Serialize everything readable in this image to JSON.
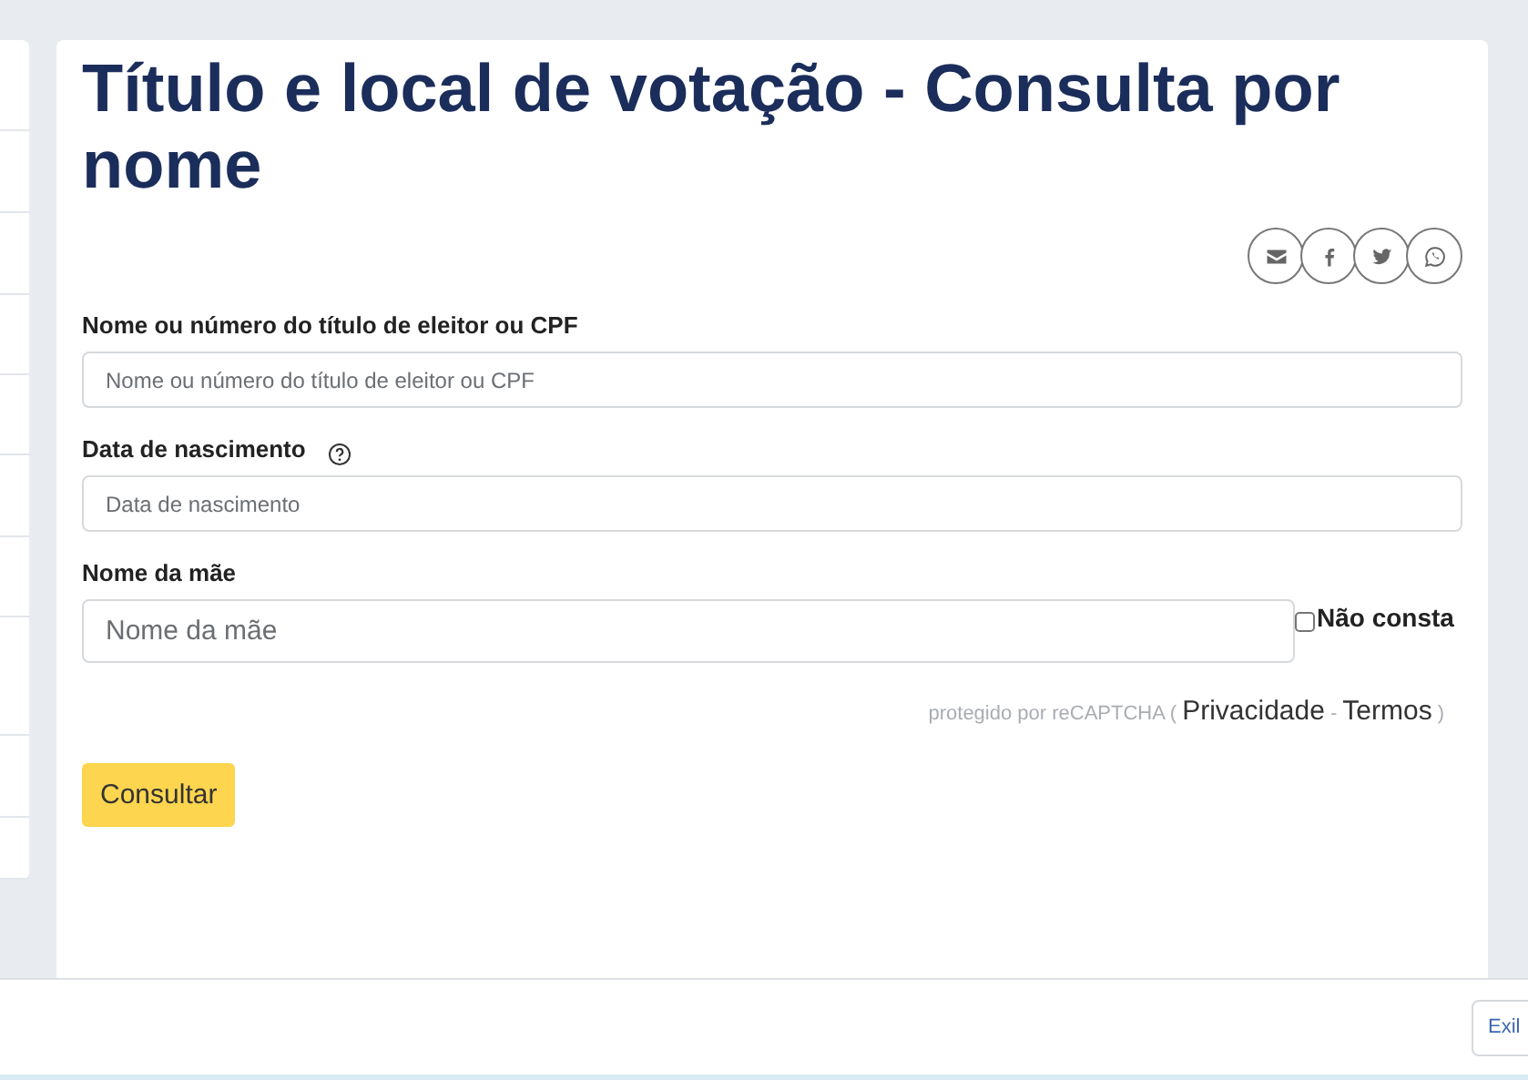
{
  "title": "Título e local de votação - Consulta por nome",
  "share_buttons": [
    {
      "kind": "email"
    },
    {
      "kind": "facebook"
    },
    {
      "kind": "twitter"
    },
    {
      "kind": "whatsapp"
    }
  ],
  "fields": [
    {
      "kind": "plain",
      "label": "Nome ou número do título de eleitor ou CPF",
      "placeholder": "Nome ou número do título de eleitor ou CPF"
    },
    {
      "kind": "help",
      "label": "Data de nascimento",
      "placeholder": "Data de nascimento"
    },
    {
      "kind": "optional",
      "label": "Nome da mãe",
      "placeholder": "Nome da mãe",
      "checkbox": {
        "label": "Não consta",
        "checked": false
      }
    }
  ],
  "recaptcha": {
    "prefix": "protegido por reCAPTCHA (",
    "links": [
      "Privacidade",
      "Termos"
    ],
    "separator": "-",
    "suffix": ")"
  },
  "submit": "Consultar",
  "footer_button": "Exil"
}
